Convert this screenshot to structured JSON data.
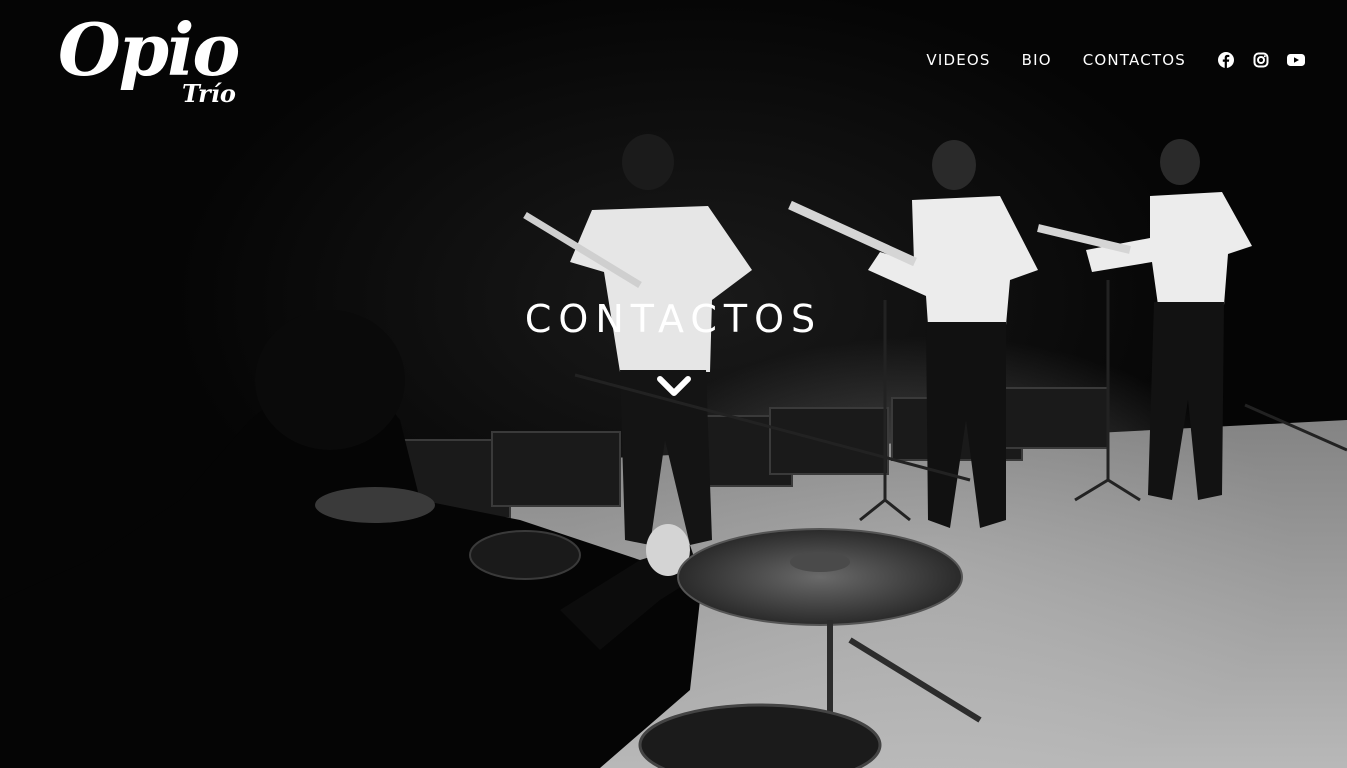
{
  "header": {
    "logo": {
      "title": "Opio",
      "subtitle": "Trío"
    },
    "nav": {
      "items": [
        "VIDEOS",
        "BIO",
        "CONTACTOS"
      ]
    },
    "social": [
      "facebook-icon",
      "instagram-icon",
      "youtube-icon"
    ]
  },
  "hero": {
    "title": "CONTACTOS",
    "scroll_icon": "chevron-down-icon"
  }
}
